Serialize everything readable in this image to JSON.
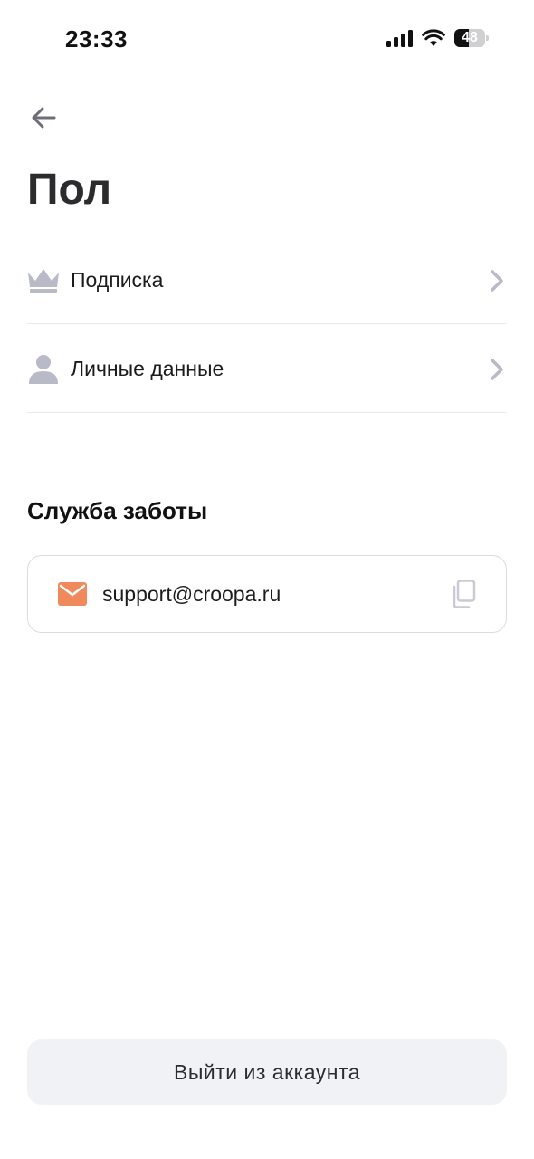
{
  "status_bar": {
    "time": "23:33",
    "battery_level": "48",
    "icons": [
      "signal-icon",
      "wifi-icon",
      "battery-icon"
    ]
  },
  "header": {
    "back_icon": "arrow-left-icon",
    "title": "Пол"
  },
  "menu": {
    "items": [
      {
        "label": "Подписка",
        "icon": "crown-icon"
      },
      {
        "label": "Личные данные",
        "icon": "person-icon"
      }
    ]
  },
  "support": {
    "title": "Служба заботы",
    "email": "support@croopa.ru",
    "icons": [
      "mail-icon",
      "copy-icon"
    ]
  },
  "logout": {
    "label": "Выйти из аккаунта"
  },
  "colors": {
    "accent_mail": "#F08A5D",
    "icon_gray": "#B9BAC8",
    "button_bg": "#F1F2F5",
    "divider": "#E9E9EC"
  }
}
